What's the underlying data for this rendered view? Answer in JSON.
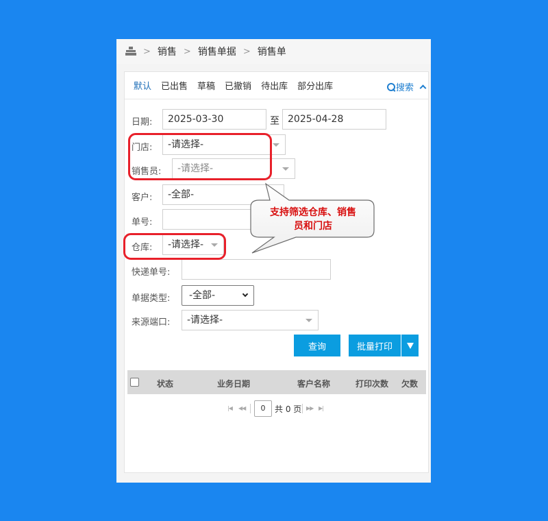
{
  "breadcrumb": [
    "销售",
    "销售单据",
    "销售单"
  ],
  "breadcrumb_separator": ">",
  "tabs": [
    {
      "label": "默认",
      "active": true
    },
    {
      "label": "已出售",
      "active": false
    },
    {
      "label": "草稿",
      "active": false
    },
    {
      "label": "已撤销",
      "active": false
    },
    {
      "label": "待出库",
      "active": false
    },
    {
      "label": "部分出库",
      "active": false
    }
  ],
  "search_toggle": "搜索",
  "filters": {
    "date_label": "日期:",
    "date_from": "2025-03-30",
    "date_to_label": "至",
    "date_to": "2025-04-28",
    "store_label": "门店:",
    "store_value": "-请选择-",
    "salesperson_label": "销售员:",
    "salesperson_value": "-请选择-",
    "customer_label": "客户:",
    "customer_value": "-全部-",
    "order_no_label": "单号:",
    "order_no_value": "",
    "warehouse_label": "仓库:",
    "warehouse_value": "-请选择-",
    "tracking_label": "快递单号:",
    "tracking_value": "",
    "doc_type_label": "单据类型:",
    "doc_type_value": "-全部-",
    "source_label": "来源端口:",
    "source_value": "-请选择-"
  },
  "buttons": {
    "query": "查询",
    "batch_print": "批量打印"
  },
  "table": {
    "columns": [
      "状态",
      "业务日期",
      "客户名称",
      "打印次数",
      "欠数"
    ]
  },
  "pager": {
    "current_page": "0",
    "total_text": "共 0 页"
  },
  "callout": {
    "text_line1": "支持筛选仓库、销售",
    "text_line2": "员和门店"
  },
  "colors": {
    "background": "#1a86f0",
    "primary_button": "#0b9de0",
    "highlight": "#e8202a",
    "callout_text": "#d80f0f"
  }
}
